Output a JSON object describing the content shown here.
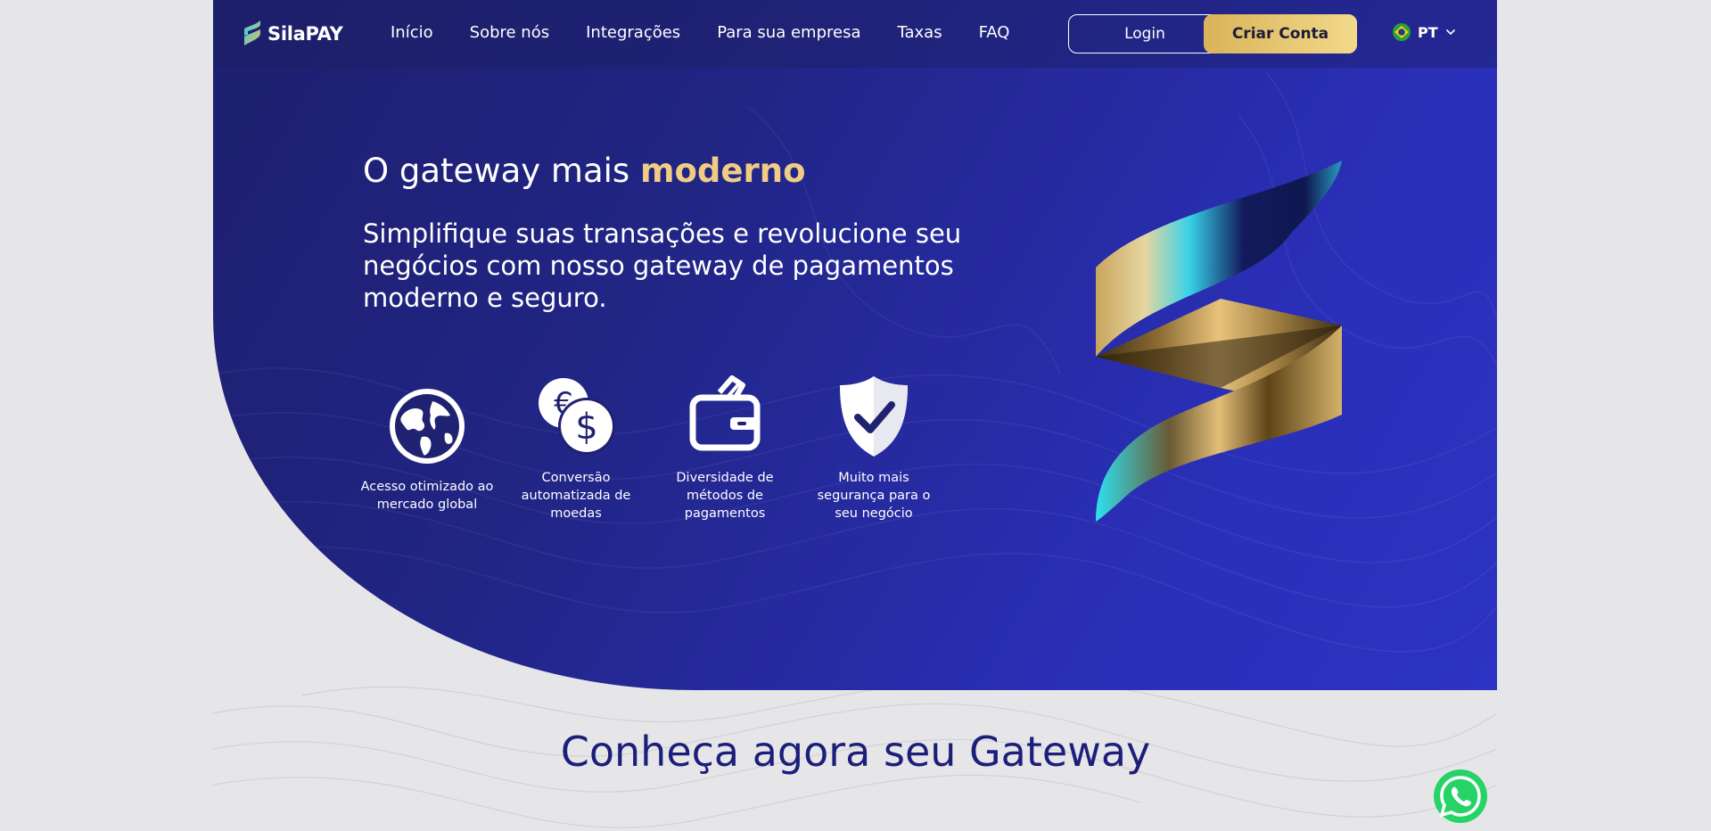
{
  "nav": {
    "logo_text": "SilaPAY",
    "links": [
      "Início",
      "Sobre nós",
      "Integrações",
      "Para sua empresa",
      "Taxas",
      "FAQ"
    ],
    "login_label": "Login",
    "signup_label": "Criar Conta",
    "language": "PT",
    "language_icon": "brazil-flag-icon"
  },
  "hero": {
    "headline_prefix": "O gateway mais ",
    "headline_accent": "moderno",
    "subheadline": "Simplifique suas transações e revolucione seu negócios com nosso gateway de pagamentos moderno e seguro.",
    "features": [
      {
        "icon": "globe-icon",
        "label": "Acesso otimizado ao mercado global"
      },
      {
        "icon": "currency-exchange-icon",
        "label": "Conversão automatizada de moedas"
      },
      {
        "icon": "wallet-icon",
        "label": "Diversidade de métodos de pagamentos"
      },
      {
        "icon": "shield-check-icon",
        "label": "Muito mais segurança para o seu negócio"
      }
    ]
  },
  "section": {
    "title": "Conheça agora seu Gateway"
  },
  "colors": {
    "hero_bg": "#2a2fb8",
    "accent_gold": "#f0cc85",
    "section_title": "#1c1f7a",
    "whatsapp": "#25d366"
  }
}
